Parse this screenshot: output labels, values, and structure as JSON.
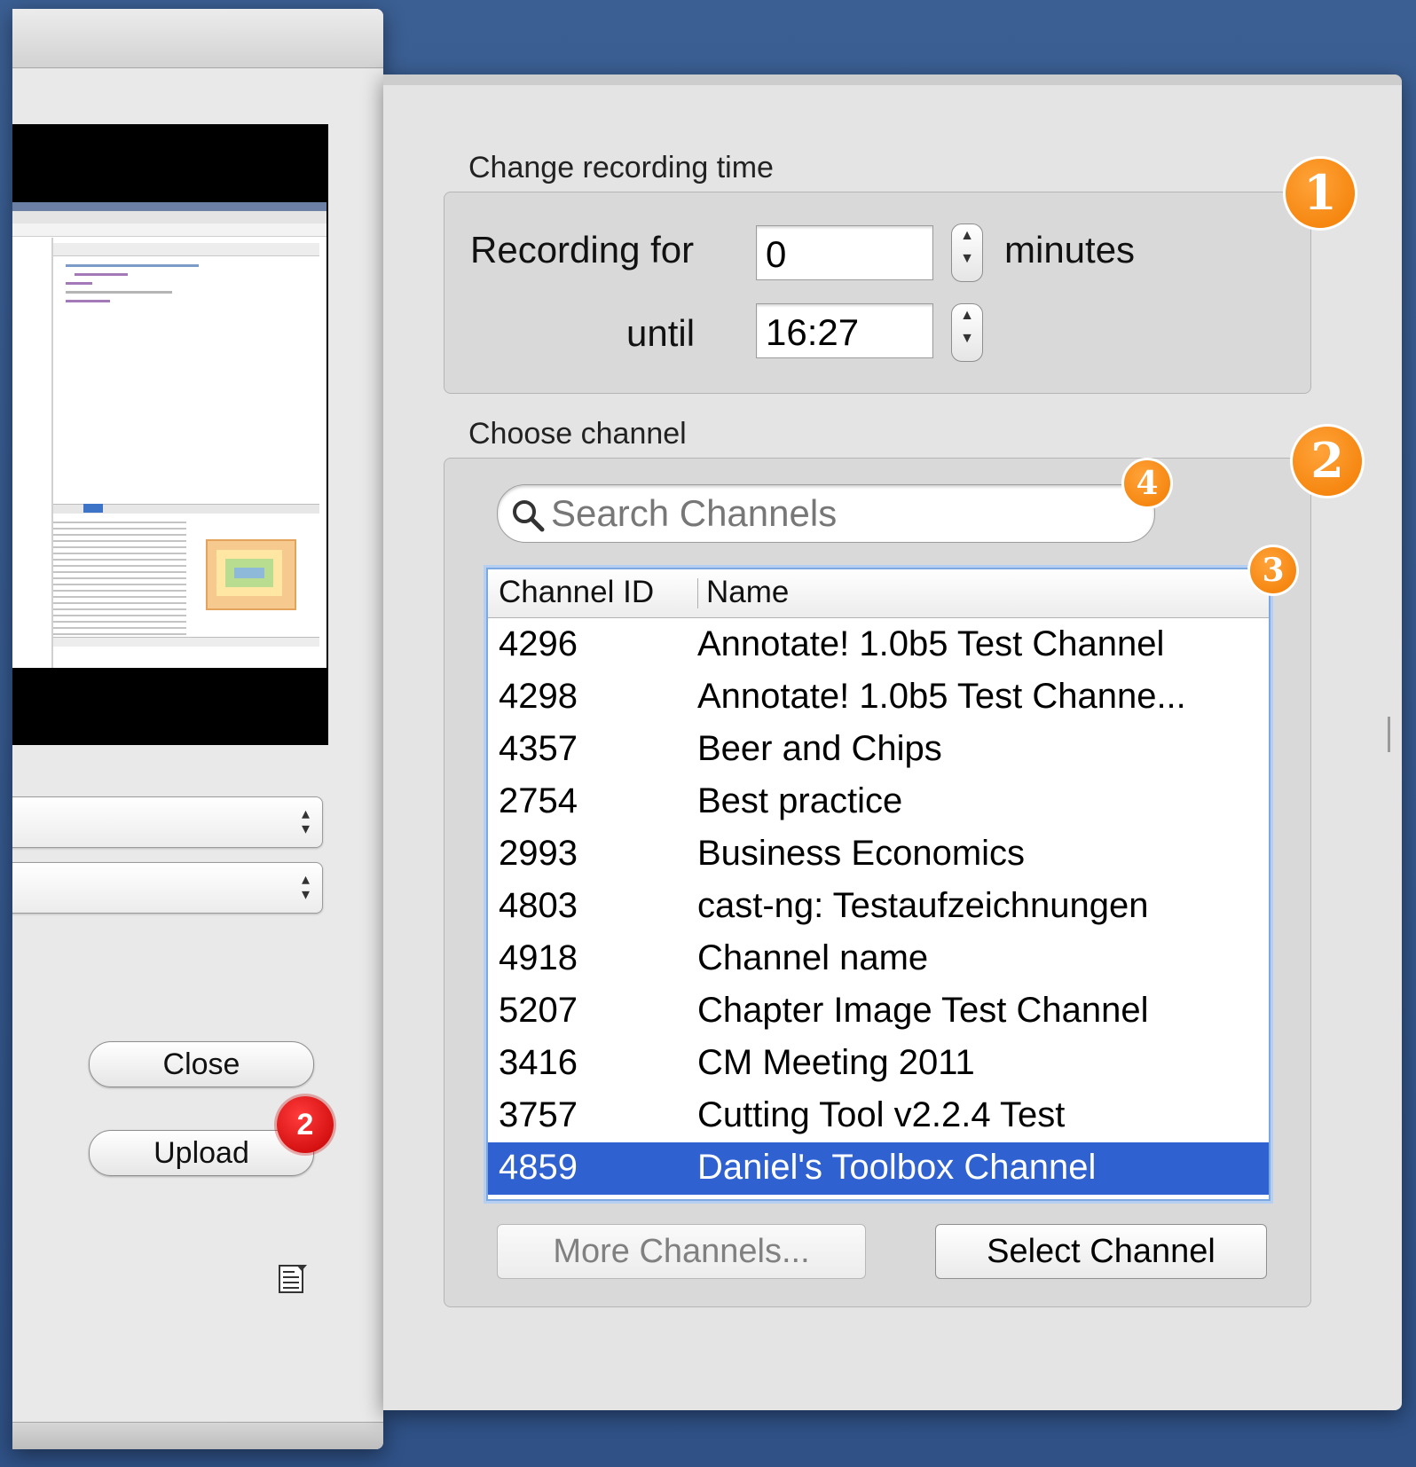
{
  "left_panel": {
    "close_label": "Close",
    "upload_label": "Upload",
    "upload_badge": "2",
    "select_arrows": "▴▾"
  },
  "recording": {
    "title": "Change recording time",
    "recording_for_label": "Recording for",
    "minutes_value": "0",
    "minutes_label": "minutes",
    "until_label": "until",
    "until_value": "16:27",
    "badge": "1"
  },
  "channel": {
    "title": "Choose channel",
    "badge": "2",
    "search_placeholder": "Search Channels",
    "search_badge": "4",
    "table_badge": "3",
    "columns": [
      "Channel ID",
      "Name"
    ],
    "rows": [
      {
        "id": "4296",
        "name": "Annotate! 1.0b5 Test Channel"
      },
      {
        "id": "4298",
        "name": "Annotate! 1.0b5 Test Channe..."
      },
      {
        "id": "4357",
        "name": "Beer and Chips"
      },
      {
        "id": "2754",
        "name": "Best practice"
      },
      {
        "id": "2993",
        "name": "Business Economics"
      },
      {
        "id": "4803",
        "name": "cast-ng: Testaufzeichnungen"
      },
      {
        "id": "4918",
        "name": "Channel name"
      },
      {
        "id": "5207",
        "name": "Chapter Image Test Channel"
      },
      {
        "id": "3416",
        "name": "CM Meeting 2011"
      },
      {
        "id": "3757",
        "name": "Cutting Tool v2.2.4 Test"
      },
      {
        "id": "4859",
        "name": "Daniel's Toolbox Channel"
      }
    ],
    "selected_row": "4859",
    "more_label": "More Channels...",
    "select_label": "Select Channel"
  },
  "colors": {
    "badge_orange": "#f27c00",
    "badge_red": "#d40000",
    "selection": "#2f62d0",
    "desktop": "#31548a"
  }
}
